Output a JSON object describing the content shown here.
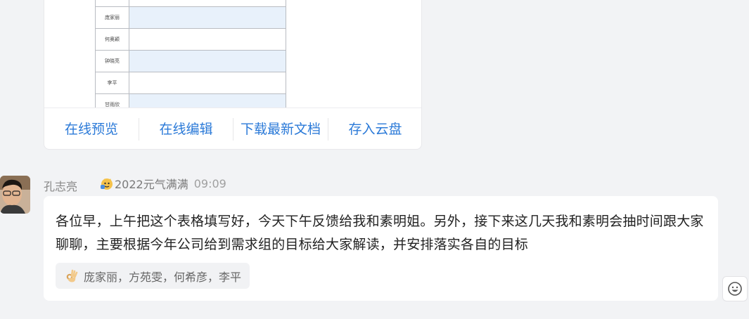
{
  "file_card": {
    "sheet_rows": [
      {
        "name": ""
      },
      {
        "name": "庞家丽"
      },
      {
        "name": "何奥颖"
      },
      {
        "name": "钟晓亮"
      },
      {
        "name": "李平"
      },
      {
        "name": "甘雨欣"
      }
    ],
    "actions": {
      "preview": "在线预览",
      "edit": "在线编辑",
      "download": "下载最新文档",
      "save_cloud": "存入云盘"
    }
  },
  "message": {
    "sender": "孔志亮",
    "badge": "2022元气满满",
    "time": "09:09",
    "text": "各位早，上午把这个表格填写好，今天下午反馈给我和素明姐。另外，接下来这几天我和素明会抽时间跟大家聊聊，主要根据今年公司给到需求组的目标给大家解读，并安排落实各自的目标",
    "reaction": {
      "icon": "ok-hand-icon",
      "users": "庞家丽，方苑雯，何希彦，李平"
    }
  },
  "colors": {
    "link": "#2b7ad8",
    "background": "#f2f3f5",
    "sheet_alt": "#e8f1fb"
  }
}
